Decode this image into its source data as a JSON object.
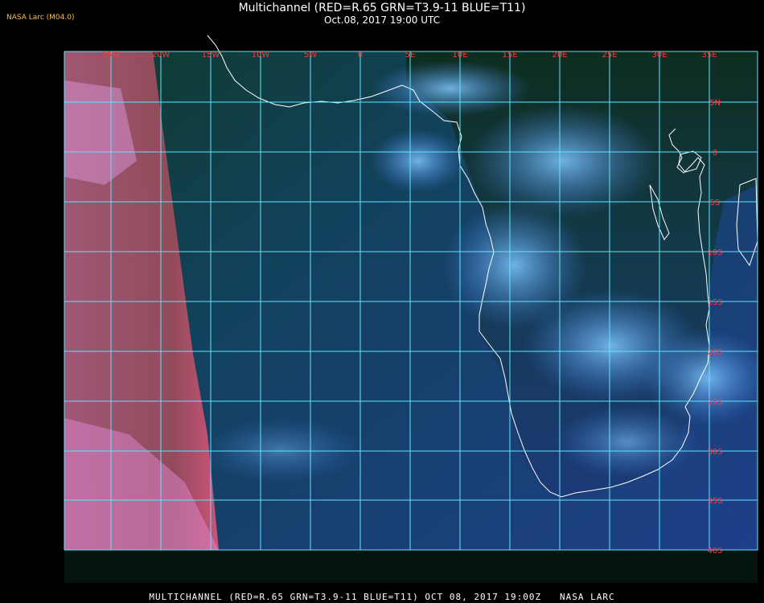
{
  "header": {
    "title": "Multichannel (RED=R.65 GRN=T3.9-11 BLUE=T11)",
    "subtitle": "Oct.08, 2017 19:00 UTC",
    "brand": "NASA Larc (M04.0)"
  },
  "footer": {
    "caption": "MULTICHANNEL (RED=R.65 GRN=T3.9-11 BLUE=T11) OCT 08, 2017 19:00Z   NASA LARC"
  },
  "map": {
    "gridline_color": "#5ee6ff",
    "coastline_color": "#ffffff",
    "label_color": "#ff3a3a",
    "longitude_labels": [
      "25W",
      "20W",
      "15W",
      "10W",
      "5W",
      "0",
      "5E",
      "10E",
      "15E",
      "20E",
      "25E",
      "30E",
      "35E"
    ],
    "latitude_labels": [
      "5N",
      "0",
      "5S",
      "10S",
      "15S",
      "20S",
      "25S",
      "30S",
      "35S",
      "40S"
    ]
  }
}
